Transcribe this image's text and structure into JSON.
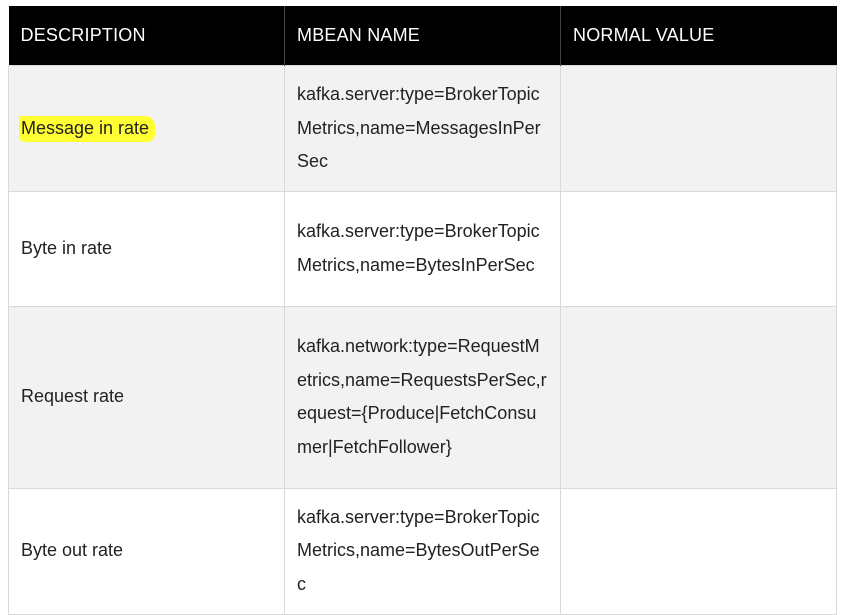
{
  "table": {
    "headers": [
      "DESCRIPTION",
      "MBEAN NAME",
      "NORMAL VALUE"
    ],
    "rows": [
      {
        "description": "Message in rate",
        "mbean": "kafka.server:type=BrokerTopicMetrics,name=MessagesInPerSec",
        "normal_value": "",
        "highlighted": true
      },
      {
        "description": "Byte in rate",
        "mbean": "kafka.server:type=BrokerTopicMetrics,name=BytesInPerSec",
        "normal_value": ""
      },
      {
        "description": "Request rate",
        "mbean": "kafka.network:type=RequestMetrics,name=RequestsPerSec,request={Produce|FetchConsumer|FetchFollower}",
        "normal_value": ""
      },
      {
        "description": "Byte out rate",
        "mbean": "kafka.server:type=BrokerTopicMetrics,name=BytesOutPerSec",
        "normal_value": ""
      }
    ]
  },
  "colors": {
    "header_bg": "#000000",
    "header_text": "#ffffff",
    "row_alt_bg": "#f2f2f2",
    "highlight": "#ffff33"
  }
}
